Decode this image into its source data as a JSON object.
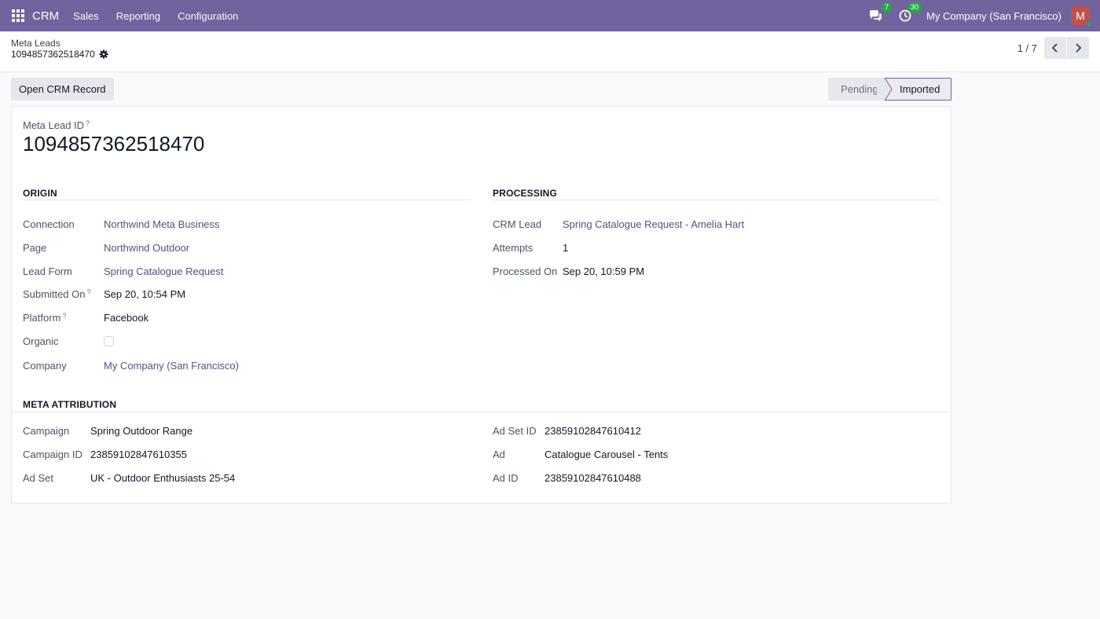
{
  "navbar": {
    "app_name": "CRM",
    "menu": [
      "Sales",
      "Reporting",
      "Configuration"
    ],
    "messages_count": "7",
    "activities_count": "30",
    "company": "My Company (San Francisco)",
    "avatar_initial": "M"
  },
  "control": {
    "breadcrumb": "Meta Leads",
    "record_title": "1094857362518470",
    "pager": "1 / 7"
  },
  "actions": {
    "open_crm_record": "Open CRM Record"
  },
  "status": {
    "stages": [
      "Pending",
      "Imported"
    ],
    "current": "Imported"
  },
  "form": {
    "meta_lead_id_label": "Meta Lead ID",
    "meta_lead_id": "1094857362518470",
    "help_mark": "?",
    "origin": {
      "title": "ORIGIN",
      "connection_label": "Connection",
      "connection": "Northwind Meta Business",
      "page_label": "Page",
      "page": "Northwind Outdoor",
      "lead_form_label": "Lead Form",
      "lead_form": "Spring Catalogue Request",
      "submitted_on_label": "Submitted On",
      "submitted_on": "Sep 20, 10:54 PM",
      "platform_label": "Platform",
      "platform": "Facebook",
      "organic_label": "Organic",
      "organic": false,
      "company_label": "Company",
      "company": "My Company (San Francisco)"
    },
    "processing": {
      "title": "PROCESSING",
      "crm_lead_label": "CRM Lead",
      "crm_lead": "Spring Catalogue Request - Amelia Hart",
      "attempts_label": "Attempts",
      "attempts": "1",
      "processed_on_label": "Processed On",
      "processed_on": "Sep 20, 10:59 PM"
    },
    "attribution": {
      "title": "META ATTRIBUTION",
      "campaign_label": "Campaign",
      "campaign": "Spring Outdoor Range",
      "campaign_id_label": "Campaign ID",
      "campaign_id": "23859102847610355",
      "ad_set_label": "Ad Set",
      "ad_set": "UK - Outdoor Enthusiasts 25-54",
      "ad_set_id_label": "Ad Set ID",
      "ad_set_id": "23859102847610412",
      "ad_label": "Ad",
      "ad": "Catalogue Carousel - Tents",
      "ad_id_label": "Ad ID",
      "ad_id": "23859102847610488"
    }
  },
  "colors": {
    "navbar": "#71639e",
    "link": "#5a4f7f",
    "badge": "#28a745",
    "avatar": "#c0504d"
  }
}
